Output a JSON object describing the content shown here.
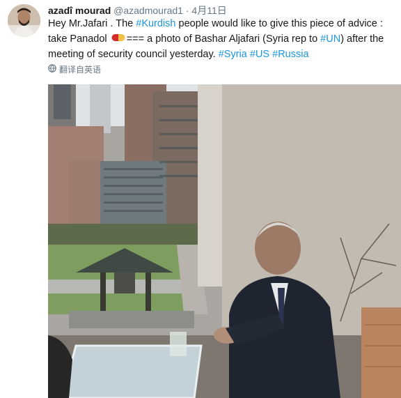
{
  "tweet": {
    "author_name": "azadî mourad",
    "handle": "@azadmourad1",
    "separator": "·",
    "timestamp": "4月11日",
    "text": {
      "p1": "Hey Mr.Jafari . The ",
      "tag1": "#Kurdish",
      "p2": " people would like to give this piece of advice : take Panadol ",
      "p3": "=== a photo of Bashar Aljafari (Syria rep to ",
      "tag2": "#UN",
      "p4": ") after the meeting of security council yesterday. ",
      "tag3": "#Syria",
      "tag4": "#US",
      "tag5": "#Russia"
    },
    "translate_label": "翻译自英语"
  },
  "icons": {
    "avatar": "avatar",
    "pill": "pill-emoji",
    "globe": "globe-icon"
  },
  "colors": {
    "link": "#1b95e0",
    "muted": "#657786"
  }
}
